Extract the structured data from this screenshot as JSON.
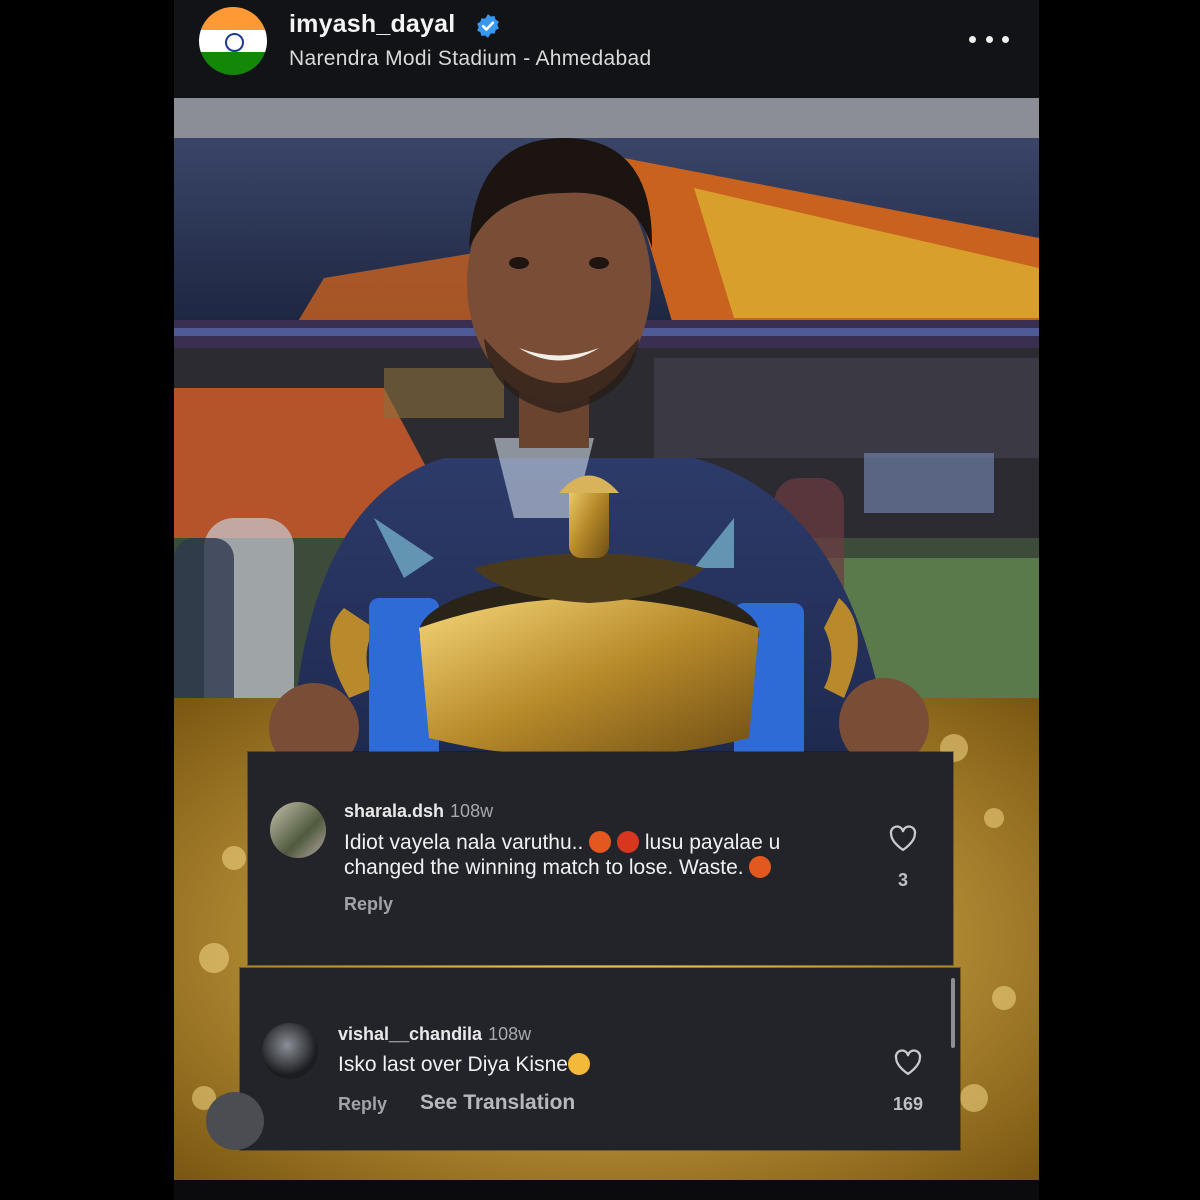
{
  "header": {
    "username": "imyash_dayal",
    "location": "Narendra Modi Stadium - Ahmedabad",
    "avatar_icon": "indian-flag-icon",
    "verified_icon": "verified-badge-icon",
    "more_icon": "more-options-icon"
  },
  "colors": {
    "saffron": "#FF9933",
    "white": "#FFFFFF",
    "green": "#138808",
    "verified_blue": "#3897f0",
    "comment_bg": "#23242a"
  },
  "comments": [
    {
      "username": "sharala.dsh",
      "time": "108w",
      "text_line1": "Idiot vayela nala varuthu..",
      "text_line1_end": "lusu payalae u",
      "text_line2": "changed the winning match to lose. Waste.",
      "emojis": [
        "angry-swearing-face-emoji",
        "angry-face-emoji",
        "angry-swearing-face-emoji"
      ],
      "reply": "Reply",
      "likes": "3"
    },
    {
      "username": "vishal__chandila",
      "time": "108w",
      "text": "Isko last over Diya Kisne",
      "emojis": [
        "crying-face-emoji"
      ],
      "reply": "Reply",
      "translation": "See Translation",
      "likes": "169"
    }
  ]
}
